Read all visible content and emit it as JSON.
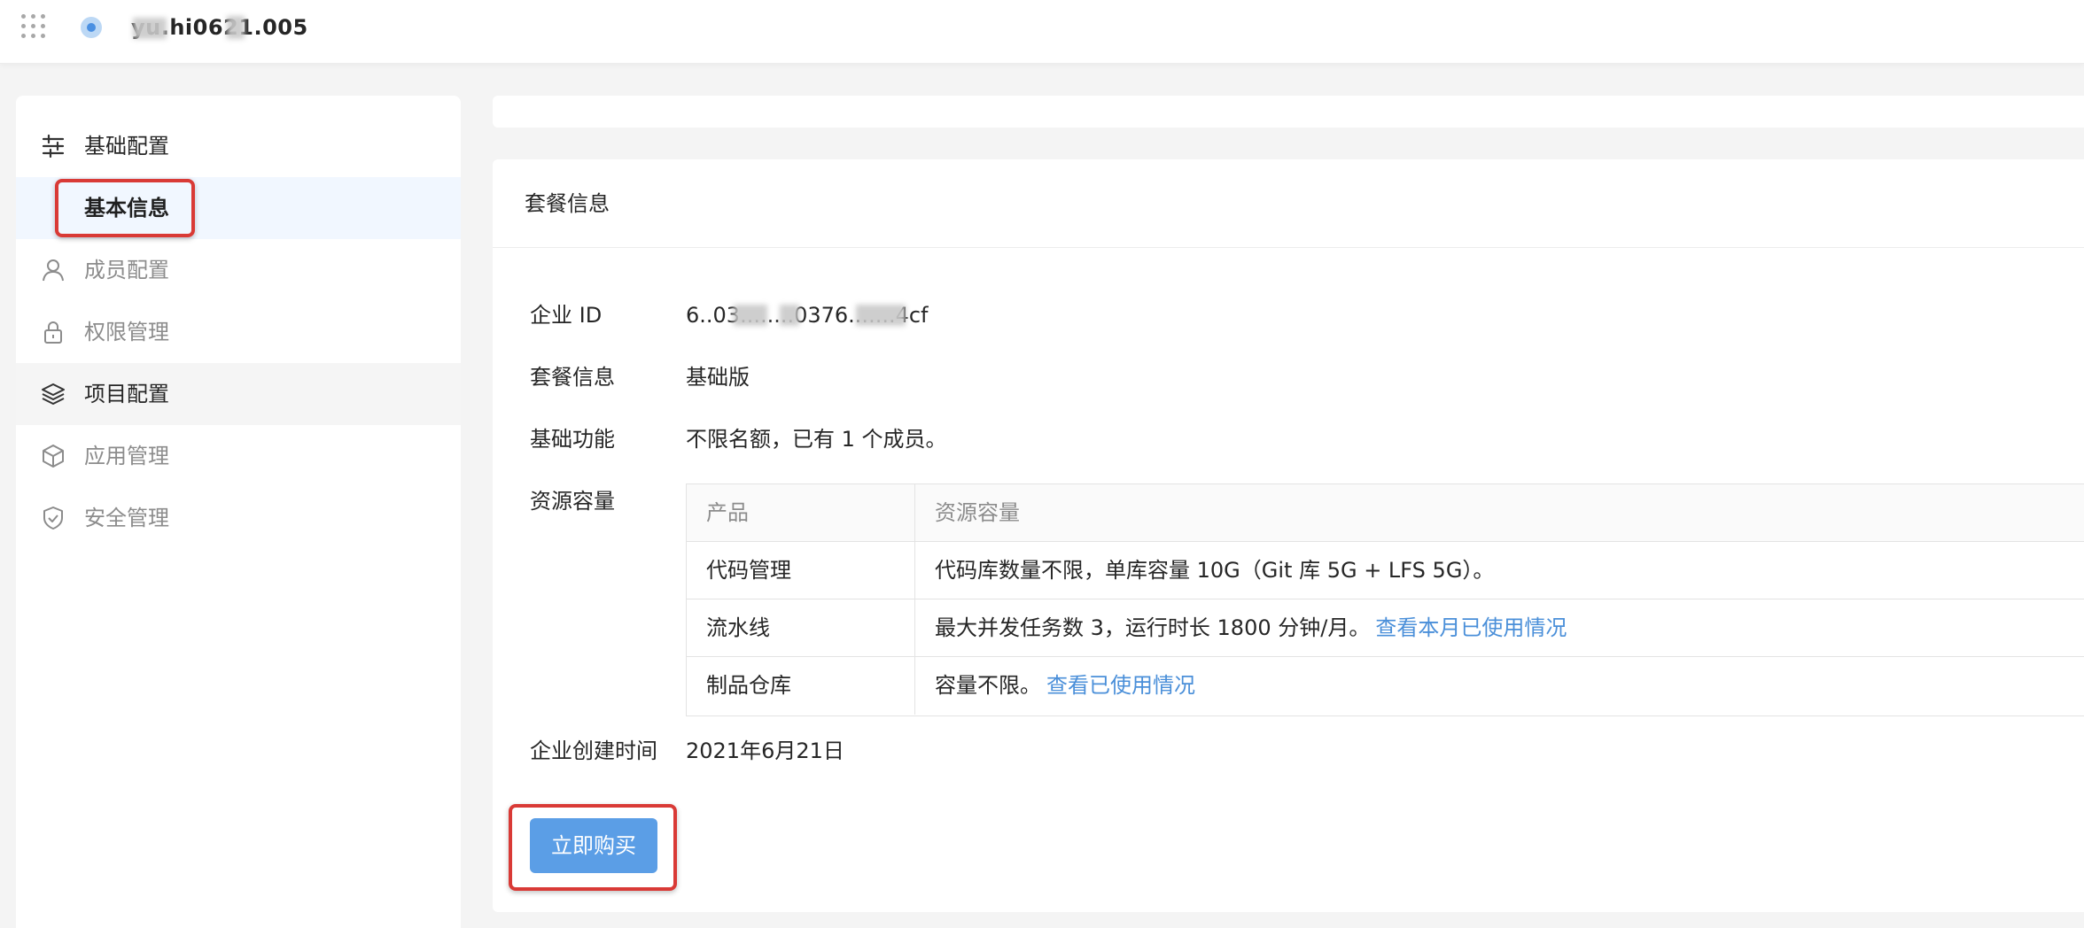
{
  "header": {
    "org_name": "yu.hi0621.005"
  },
  "sidebar": {
    "items": [
      {
        "label": "基础配置",
        "icon": "sliders-icon",
        "kind": "group"
      },
      {
        "label": "基本信息",
        "icon": "",
        "kind": "active"
      },
      {
        "label": "成员配置",
        "icon": "user-icon",
        "kind": "item"
      },
      {
        "label": "权限管理",
        "icon": "lock-icon",
        "kind": "item"
      },
      {
        "label": "项目配置",
        "icon": "layers-icon",
        "kind": "group"
      },
      {
        "label": "应用管理",
        "icon": "cube-icon",
        "kind": "item"
      },
      {
        "label": "安全管理",
        "icon": "shield-check-icon",
        "kind": "item"
      }
    ]
  },
  "card": {
    "title": "套餐信息",
    "fields": {
      "enterprise_id_label": "企业 ID",
      "enterprise_id_value": "6..03........0376.......4cf",
      "plan_label": "套餐信息",
      "plan_value": "基础版",
      "basic_label": "基础功能",
      "basic_value": "不限名额，已有 1 个成员。",
      "resource_label": "资源容量",
      "created_label": "企业创建时间",
      "created_value": "2021年6月21日"
    },
    "table": {
      "headers": [
        "产品",
        "资源容量"
      ],
      "rows": [
        {
          "product": "代码管理",
          "capacity": "代码库数量不限，单库容量 10G（Git 库 5G + LFS 5G）。",
          "link": ""
        },
        {
          "product": "流水线",
          "capacity": "最大并发任务数 3，运行时长 1800 分钟/月。",
          "link": "查看本月已使用情况"
        },
        {
          "product": "制品仓库",
          "capacity": "容量不限。",
          "link": "查看已使用情况"
        }
      ]
    },
    "buy_button": "立即购买"
  },
  "colors": {
    "accent": "#5b9ee6",
    "link": "#4a8fd9",
    "highlight_box": "#d93a36"
  }
}
